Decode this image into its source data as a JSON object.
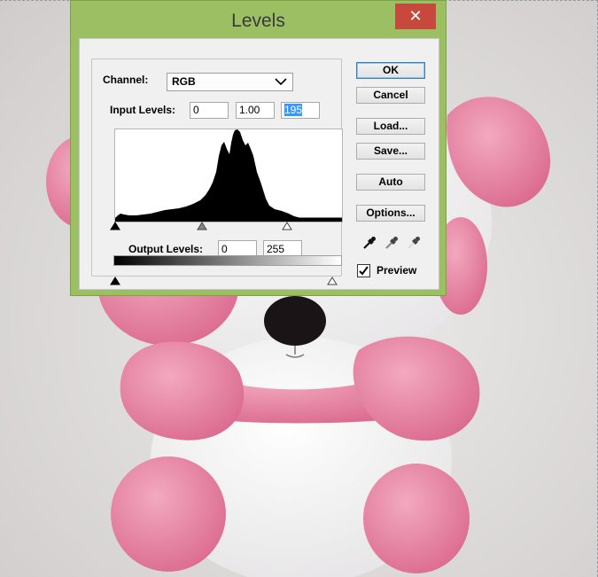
{
  "dialog": {
    "title": "Levels",
    "close_glyph": "✕",
    "channel_label": "Channel:",
    "channel_value": "RGB",
    "input_label": "Input Levels:",
    "input_black": "0",
    "input_gamma": "1.00",
    "input_white": "195",
    "output_label": "Output Levels:",
    "output_black": "0",
    "output_white": "255",
    "buttons": {
      "ok": "OK",
      "cancel": "Cancel",
      "load": "Load...",
      "save": "Save...",
      "auto": "Auto",
      "options": "Options..."
    },
    "preview_label": "Preview",
    "preview_checked": true
  },
  "icons": {
    "close": "close-icon",
    "dropdown": "chevron-down-icon",
    "black_eyedropper": "eyedropper-black-icon",
    "gray_eyedropper": "eyedropper-gray-icon",
    "white_eyedropper": "eyedropper-white-icon",
    "check": "checkmark-icon"
  },
  "colors": {
    "window_frame": "#9bbf62",
    "close_button": "#c7483d",
    "selection": "#3399ff"
  }
}
